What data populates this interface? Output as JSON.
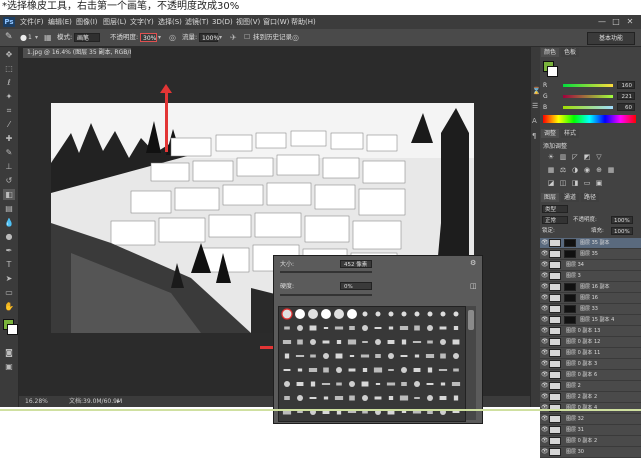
{
  "caption": "*选择橡皮工具，右击第一个画笔，不透明度改成30%",
  "app": {
    "logo": "Ps",
    "menu": [
      "文件(F)",
      "编辑(E)",
      "图像(I)",
      "图层(L)",
      "文字(Y)",
      "选择(S)",
      "滤镜(T)",
      "3D(D)",
      "视图(V)",
      "窗口(W)",
      "帮助(H)"
    ],
    "window_buttons": [
      "—",
      "□",
      "✕"
    ]
  },
  "options_bar": {
    "brush_size": "1",
    "mode_label": "模式:",
    "mode_value": "画笔",
    "opacity_label": "不透明度:",
    "opacity_value": "30%",
    "flow_label": "流量:",
    "flow_value": "100%",
    "history_label": "抹到历史记录",
    "workspace": "基本功能"
  },
  "document": {
    "tab_title": "1.jpg @ 16.4% (图层 35 副本, RGB/8#) *",
    "zoom": "16.28%",
    "doc_info": "文档:39.0M/60.9M"
  },
  "color_panel": {
    "tabs": [
      "颜色",
      "色板"
    ],
    "channels": [
      {
        "label": "R",
        "value": "160",
        "gradient": "#ff0000"
      },
      {
        "label": "G",
        "value": "221",
        "gradient": "#00ff00"
      },
      {
        "label": "B",
        "value": "60",
        "gradient": "#0000ff"
      }
    ],
    "fg_color": "#7ab33c"
  },
  "adjustments_panel": {
    "tabs": [
      "调整",
      "样式"
    ],
    "title": "添加调整"
  },
  "layers_panel": {
    "tabs": [
      "图层",
      "通道",
      "路径"
    ],
    "kind_label": "类型",
    "blend_mode": "正常",
    "opacity_label": "不透明度:",
    "opacity_value": "100%",
    "lock_label": "锁定:",
    "fill_label": "填充:",
    "fill_value": "100%",
    "layers": [
      {
        "name": "图层 35 副本",
        "mask": true,
        "selected": true
      },
      {
        "name": "图层 35",
        "mask": true,
        "selected": false
      },
      {
        "name": "图层 34",
        "mask": false,
        "selected": false
      },
      {
        "name": "图层 3",
        "mask": false,
        "selected": false
      },
      {
        "name": "图层 16 副本",
        "mask": true,
        "selected": false
      },
      {
        "name": "图层 16",
        "mask": true,
        "selected": false
      },
      {
        "name": "图层 33",
        "mask": true,
        "selected": false
      },
      {
        "name": "图层 15 副本 4",
        "mask": true,
        "selected": false
      },
      {
        "name": "图层 0 副本 13",
        "mask": false,
        "selected": false
      },
      {
        "name": "图层 0 副本 12",
        "mask": false,
        "selected": false
      },
      {
        "name": "图层 0 副本 11",
        "mask": false,
        "selected": false
      },
      {
        "name": "图层 0 副本 3",
        "mask": false,
        "selected": false
      },
      {
        "name": "图层 0 副本 6",
        "mask": false,
        "selected": false
      },
      {
        "name": "图层 2",
        "mask": false,
        "selected": false
      },
      {
        "name": "图层 2 副本 2",
        "mask": false,
        "selected": false
      },
      {
        "name": "图层 0 副本 4",
        "mask": false,
        "selected": false
      },
      {
        "name": "图层 32",
        "mask": false,
        "selected": false
      },
      {
        "name": "图层 31",
        "mask": false,
        "selected": false
      },
      {
        "name": "图层 0 副本 2",
        "mask": false,
        "selected": false
      },
      {
        "name": "图层 30",
        "mask": false,
        "selected": false
      }
    ]
  },
  "brush_popup": {
    "size_label": "大小:",
    "size_value": "452 像素",
    "hardness_label": "硬度:",
    "hardness_value": "0%"
  }
}
